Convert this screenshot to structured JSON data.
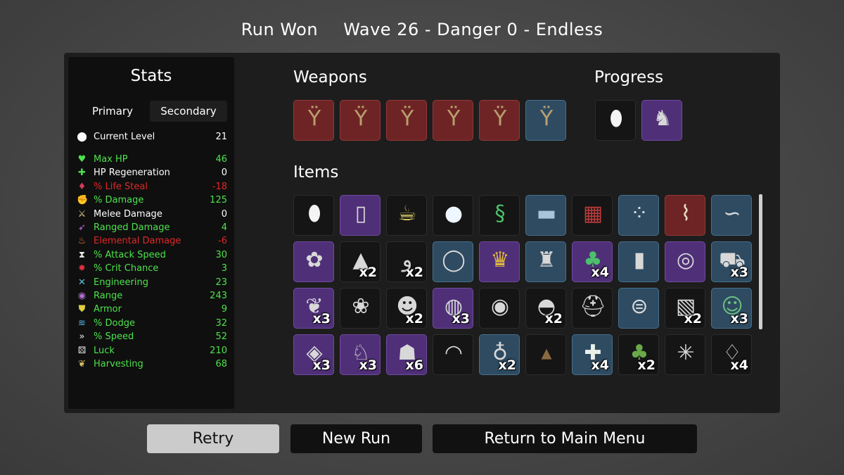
{
  "header": {
    "status": "Run Won",
    "wave": "Wave 26 - Danger 0 - Endless"
  },
  "stats": {
    "title": "Stats",
    "tabs": {
      "primary": "Primary",
      "secondary": "Secondary"
    },
    "rows": [
      {
        "icon": "current-level-icon",
        "glyph": "⬤",
        "label": "Current Level",
        "value": "21",
        "color": "#ffffff",
        "icon_color": "#ffffff"
      },
      {
        "icon": "max-hp-icon",
        "glyph": "♥",
        "label": "Max HP",
        "value": "46",
        "color": "#4de24d",
        "icon_color": "#4de24d"
      },
      {
        "icon": "hp-regeneration-icon",
        "glyph": "✚",
        "label": "HP Regeneration",
        "value": "0",
        "color": "#ffffff",
        "icon_color": "#4de24d"
      },
      {
        "icon": "life-steal-icon",
        "glyph": "♦",
        "label": "% Life Steal",
        "value": "-18",
        "color": "#e02828",
        "icon_color": "#d23a5a"
      },
      {
        "icon": "damage-icon",
        "glyph": "✊",
        "label": "% Damage",
        "value": "125",
        "color": "#4de24d",
        "icon_color": "#e0606a"
      },
      {
        "icon": "melee-damage-icon",
        "glyph": "⚔",
        "label": "Melee Damage",
        "value": "0",
        "color": "#ffffff",
        "icon_color": "#e8d8a0"
      },
      {
        "icon": "ranged-damage-icon",
        "glyph": "➶",
        "label": "Ranged Damage",
        "value": "4",
        "color": "#4de24d",
        "icon_color": "#c070e0"
      },
      {
        "icon": "elemental-damage-icon",
        "glyph": "♨",
        "label": "Elemental Damage",
        "value": "-6",
        "color": "#e02828",
        "icon_color": "#f08040"
      },
      {
        "icon": "attack-speed-icon",
        "glyph": "⧗",
        "label": "% Attack Speed",
        "value": "30",
        "color": "#4de24d",
        "icon_color": "#e8e8e8"
      },
      {
        "icon": "crit-chance-icon",
        "glyph": "✸",
        "label": "% Crit Chance",
        "value": "3",
        "color": "#4de24d",
        "icon_color": "#e03040"
      },
      {
        "icon": "engineering-icon",
        "glyph": "✕",
        "label": "Engineering",
        "value": "23",
        "color": "#4de24d",
        "icon_color": "#60c0e0"
      },
      {
        "icon": "range-icon",
        "glyph": "◉",
        "label": "Range",
        "value": "243",
        "color": "#4de24d",
        "icon_color": "#b070d0"
      },
      {
        "icon": "armor-icon",
        "glyph": "⛊",
        "label": "Armor",
        "value": "9",
        "color": "#4de24d",
        "icon_color": "#e0d040"
      },
      {
        "icon": "dodge-icon",
        "glyph": "≋",
        "label": "% Dodge",
        "value": "32",
        "color": "#4de24d",
        "icon_color": "#60b8e0"
      },
      {
        "icon": "speed-icon",
        "glyph": "»",
        "label": "% Speed",
        "value": "52",
        "color": "#4de24d",
        "icon_color": "#e8e8e8"
      },
      {
        "icon": "luck-icon",
        "glyph": "⚄",
        "label": "Luck",
        "value": "210",
        "color": "#4de24d",
        "icon_color": "#e8e8e8"
      },
      {
        "icon": "harvesting-icon",
        "glyph": "❦",
        "label": "Harvesting",
        "value": "68",
        "color": "#4de24d",
        "icon_color": "#d8c060"
      }
    ]
  },
  "weapons": {
    "title": "Weapons",
    "slots": [
      {
        "icon": "slingshot-icon",
        "glyph": "Ϋ",
        "tier": 3
      },
      {
        "icon": "slingshot-icon",
        "glyph": "Ϋ",
        "tier": 3
      },
      {
        "icon": "slingshot-icon",
        "glyph": "Ϋ",
        "tier": 3
      },
      {
        "icon": "slingshot-icon",
        "glyph": "Ϋ",
        "tier": 3
      },
      {
        "icon": "slingshot-icon",
        "glyph": "Ϋ",
        "tier": 3
      },
      {
        "icon": "slingshot-icon",
        "glyph": "Ϋ",
        "tier": 1
      }
    ]
  },
  "progress": {
    "title": "Progress",
    "slots": [
      {
        "icon": "egg-icon",
        "glyph": "⬮",
        "tier": 0
      },
      {
        "icon": "cat-statue-icon",
        "glyph": "♞",
        "tier": 2
      }
    ]
  },
  "items": {
    "title": "Items",
    "rows": [
      [
        {
          "icon": "egg-creature-icon",
          "glyph": "⬮",
          "tier": 0,
          "count": ""
        },
        {
          "icon": "baby-bottle-icon",
          "glyph": "▯",
          "tier": 2,
          "count": ""
        },
        {
          "icon": "lemonade-icon",
          "glyph": "☕",
          "tier": 0,
          "count": ""
        },
        {
          "icon": "snowball-icon",
          "glyph": "●",
          "tier": 0,
          "count": ""
        },
        {
          "icon": "snake-icon",
          "glyph": "§",
          "tier": 0,
          "count": ""
        },
        {
          "icon": "book-icon",
          "glyph": "▬",
          "tier": 1,
          "count": ""
        },
        {
          "icon": "plaid-shirt-icon",
          "glyph": "▦",
          "tier": 0,
          "count": ""
        },
        {
          "icon": "bowling-ball-icon",
          "glyph": "⁘",
          "tier": 1,
          "count": ""
        },
        {
          "icon": "scroll-icon",
          "glyph": "⌇",
          "tier": 3,
          "count": ""
        },
        {
          "icon": "worm-icon",
          "glyph": "∽",
          "tier": 1,
          "count": ""
        }
      ],
      [
        {
          "icon": "brain-icon",
          "glyph": "✿",
          "tier": 2,
          "count": ""
        },
        {
          "icon": "rocket-icon",
          "glyph": "▲",
          "tier": 0,
          "count": "x2"
        },
        {
          "icon": "tongue-icon",
          "glyph": "ﻭ",
          "tier": 0,
          "count": "x2"
        },
        {
          "icon": "pendant-icon",
          "glyph": "◯",
          "tier": 1,
          "count": ""
        },
        {
          "icon": "crown-icon",
          "glyph": "♛",
          "tier": 2,
          "count": ""
        },
        {
          "icon": "castle-icon",
          "glyph": "♜",
          "tier": 1,
          "count": ""
        },
        {
          "icon": "clover-icon",
          "glyph": "♣",
          "tier": 2,
          "count": "x4"
        },
        {
          "icon": "armor-plate-icon",
          "glyph": "▮",
          "tier": 1,
          "count": ""
        },
        {
          "icon": "robot-icon",
          "glyph": "◎",
          "tier": 2,
          "count": ""
        },
        {
          "icon": "wheelbarrow-icon",
          "glyph": "⛟",
          "tier": 1,
          "count": "x3"
        }
      ],
      [
        {
          "icon": "wings-icon",
          "glyph": "❦",
          "tier": 2,
          "count": "x3"
        },
        {
          "icon": "seed-bag-icon",
          "glyph": "❀",
          "tier": 0,
          "count": ""
        },
        {
          "icon": "pig-icon",
          "glyph": "☻",
          "tier": 0,
          "count": "x2"
        },
        {
          "icon": "shield-icon",
          "glyph": "◍",
          "tier": 2,
          "count": "x3"
        },
        {
          "icon": "turret-icon",
          "glyph": "◉",
          "tier": 0,
          "count": ""
        },
        {
          "icon": "landmine-icon",
          "glyph": "◓",
          "tier": 0,
          "count": "x2"
        },
        {
          "icon": "knight-helmet-icon",
          "glyph": "⛑",
          "tier": 0,
          "count": ""
        },
        {
          "icon": "golden-helmet-icon",
          "glyph": "⊜",
          "tier": 1,
          "count": ""
        },
        {
          "icon": "treasure-map-icon",
          "glyph": "▧",
          "tier": 0,
          "count": "x2"
        },
        {
          "icon": "frog-icon",
          "glyph": "☺",
          "tier": 1,
          "count": "x3"
        }
      ],
      [
        {
          "icon": "orb-icon",
          "glyph": "◈",
          "tier": 2,
          "count": "x3"
        },
        {
          "icon": "rabbit-icon",
          "glyph": "♘",
          "tier": 2,
          "count": "x3"
        },
        {
          "icon": "ninja-icon",
          "glyph": "☗",
          "tier": 2,
          "count": "x6"
        },
        {
          "icon": "helmet-icon",
          "glyph": "◠",
          "tier": 0,
          "count": ""
        },
        {
          "icon": "hand-mirror-icon",
          "glyph": "♁",
          "tier": 1,
          "count": "x2"
        },
        {
          "icon": "poop-icon",
          "glyph": "▴",
          "tier": 0,
          "count": ""
        },
        {
          "icon": "medkit-icon",
          "glyph": "✚",
          "tier": 1,
          "count": "x4"
        },
        {
          "icon": "tree-icon",
          "glyph": "♣",
          "tier": 0,
          "count": "x2"
        },
        {
          "icon": "palm-tree-icon",
          "glyph": "✳",
          "tier": 0,
          "count": ""
        },
        {
          "icon": "candle-icon",
          "glyph": "♢",
          "tier": 0,
          "count": "x4"
        }
      ]
    ]
  },
  "buttons": {
    "retry": "Retry",
    "new_run": "New Run",
    "main_menu": "Return to Main Menu"
  }
}
